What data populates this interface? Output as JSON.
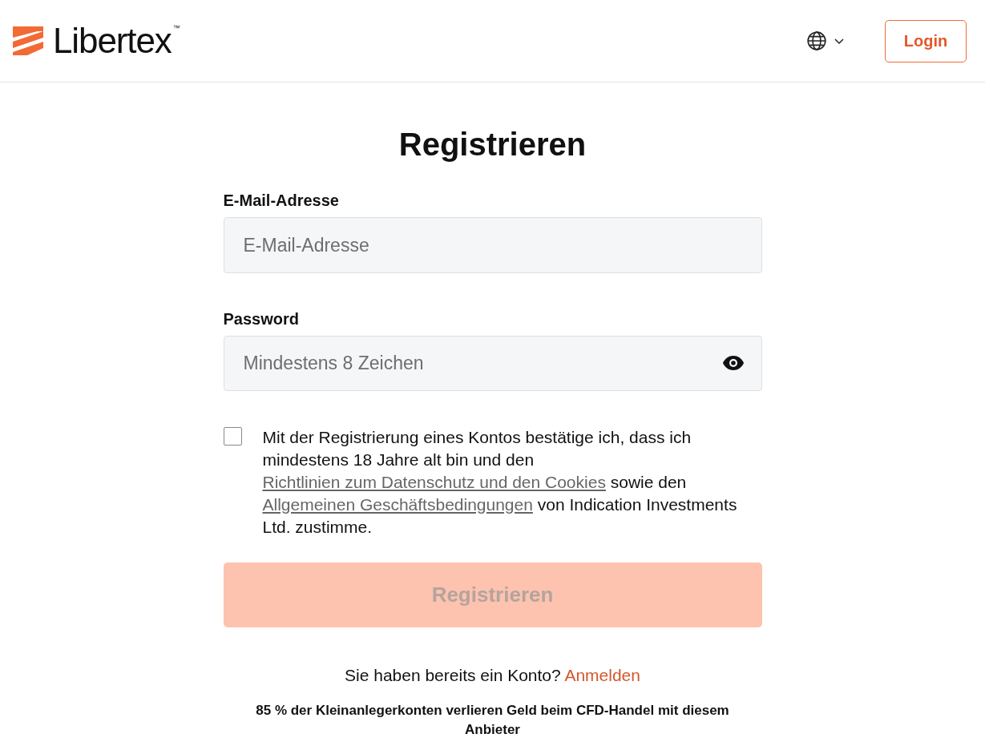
{
  "header": {
    "logo_text": "Libertex",
    "trademark": "™",
    "login_button": "Login"
  },
  "form": {
    "title": "Registrieren",
    "email": {
      "label": "E-Mail-Adresse",
      "placeholder": "E-Mail-Adresse"
    },
    "password": {
      "label": "Password",
      "placeholder": "Mindestens 8 Zeichen"
    },
    "consent": {
      "checked": false,
      "parts": [
        {
          "kind": "text",
          "text": "Mit der Registrierung eines Kontos bestätige ich, dass ich mindestens 18 Jahre alt bin und den "
        },
        {
          "kind": "link",
          "text": "Richtlinien zum Datenschutz und den Cookies"
        },
        {
          "kind": "text",
          "text": " sowie den "
        },
        {
          "kind": "link",
          "text": "Allgemeinen Geschäftsbedingungen"
        },
        {
          "kind": "text",
          "text": " von Indication Investments Ltd. zustimme."
        }
      ]
    },
    "submit": {
      "label": "Registrieren",
      "disabled": true
    },
    "login_prompt": {
      "text": "Sie haben bereits ein Konto?",
      "link": "Anmelden"
    },
    "risk_warning": "85 % der Kleinanlegerkonten verlieren Geld beim CFD-Handel mit diesem Anbieter"
  }
}
